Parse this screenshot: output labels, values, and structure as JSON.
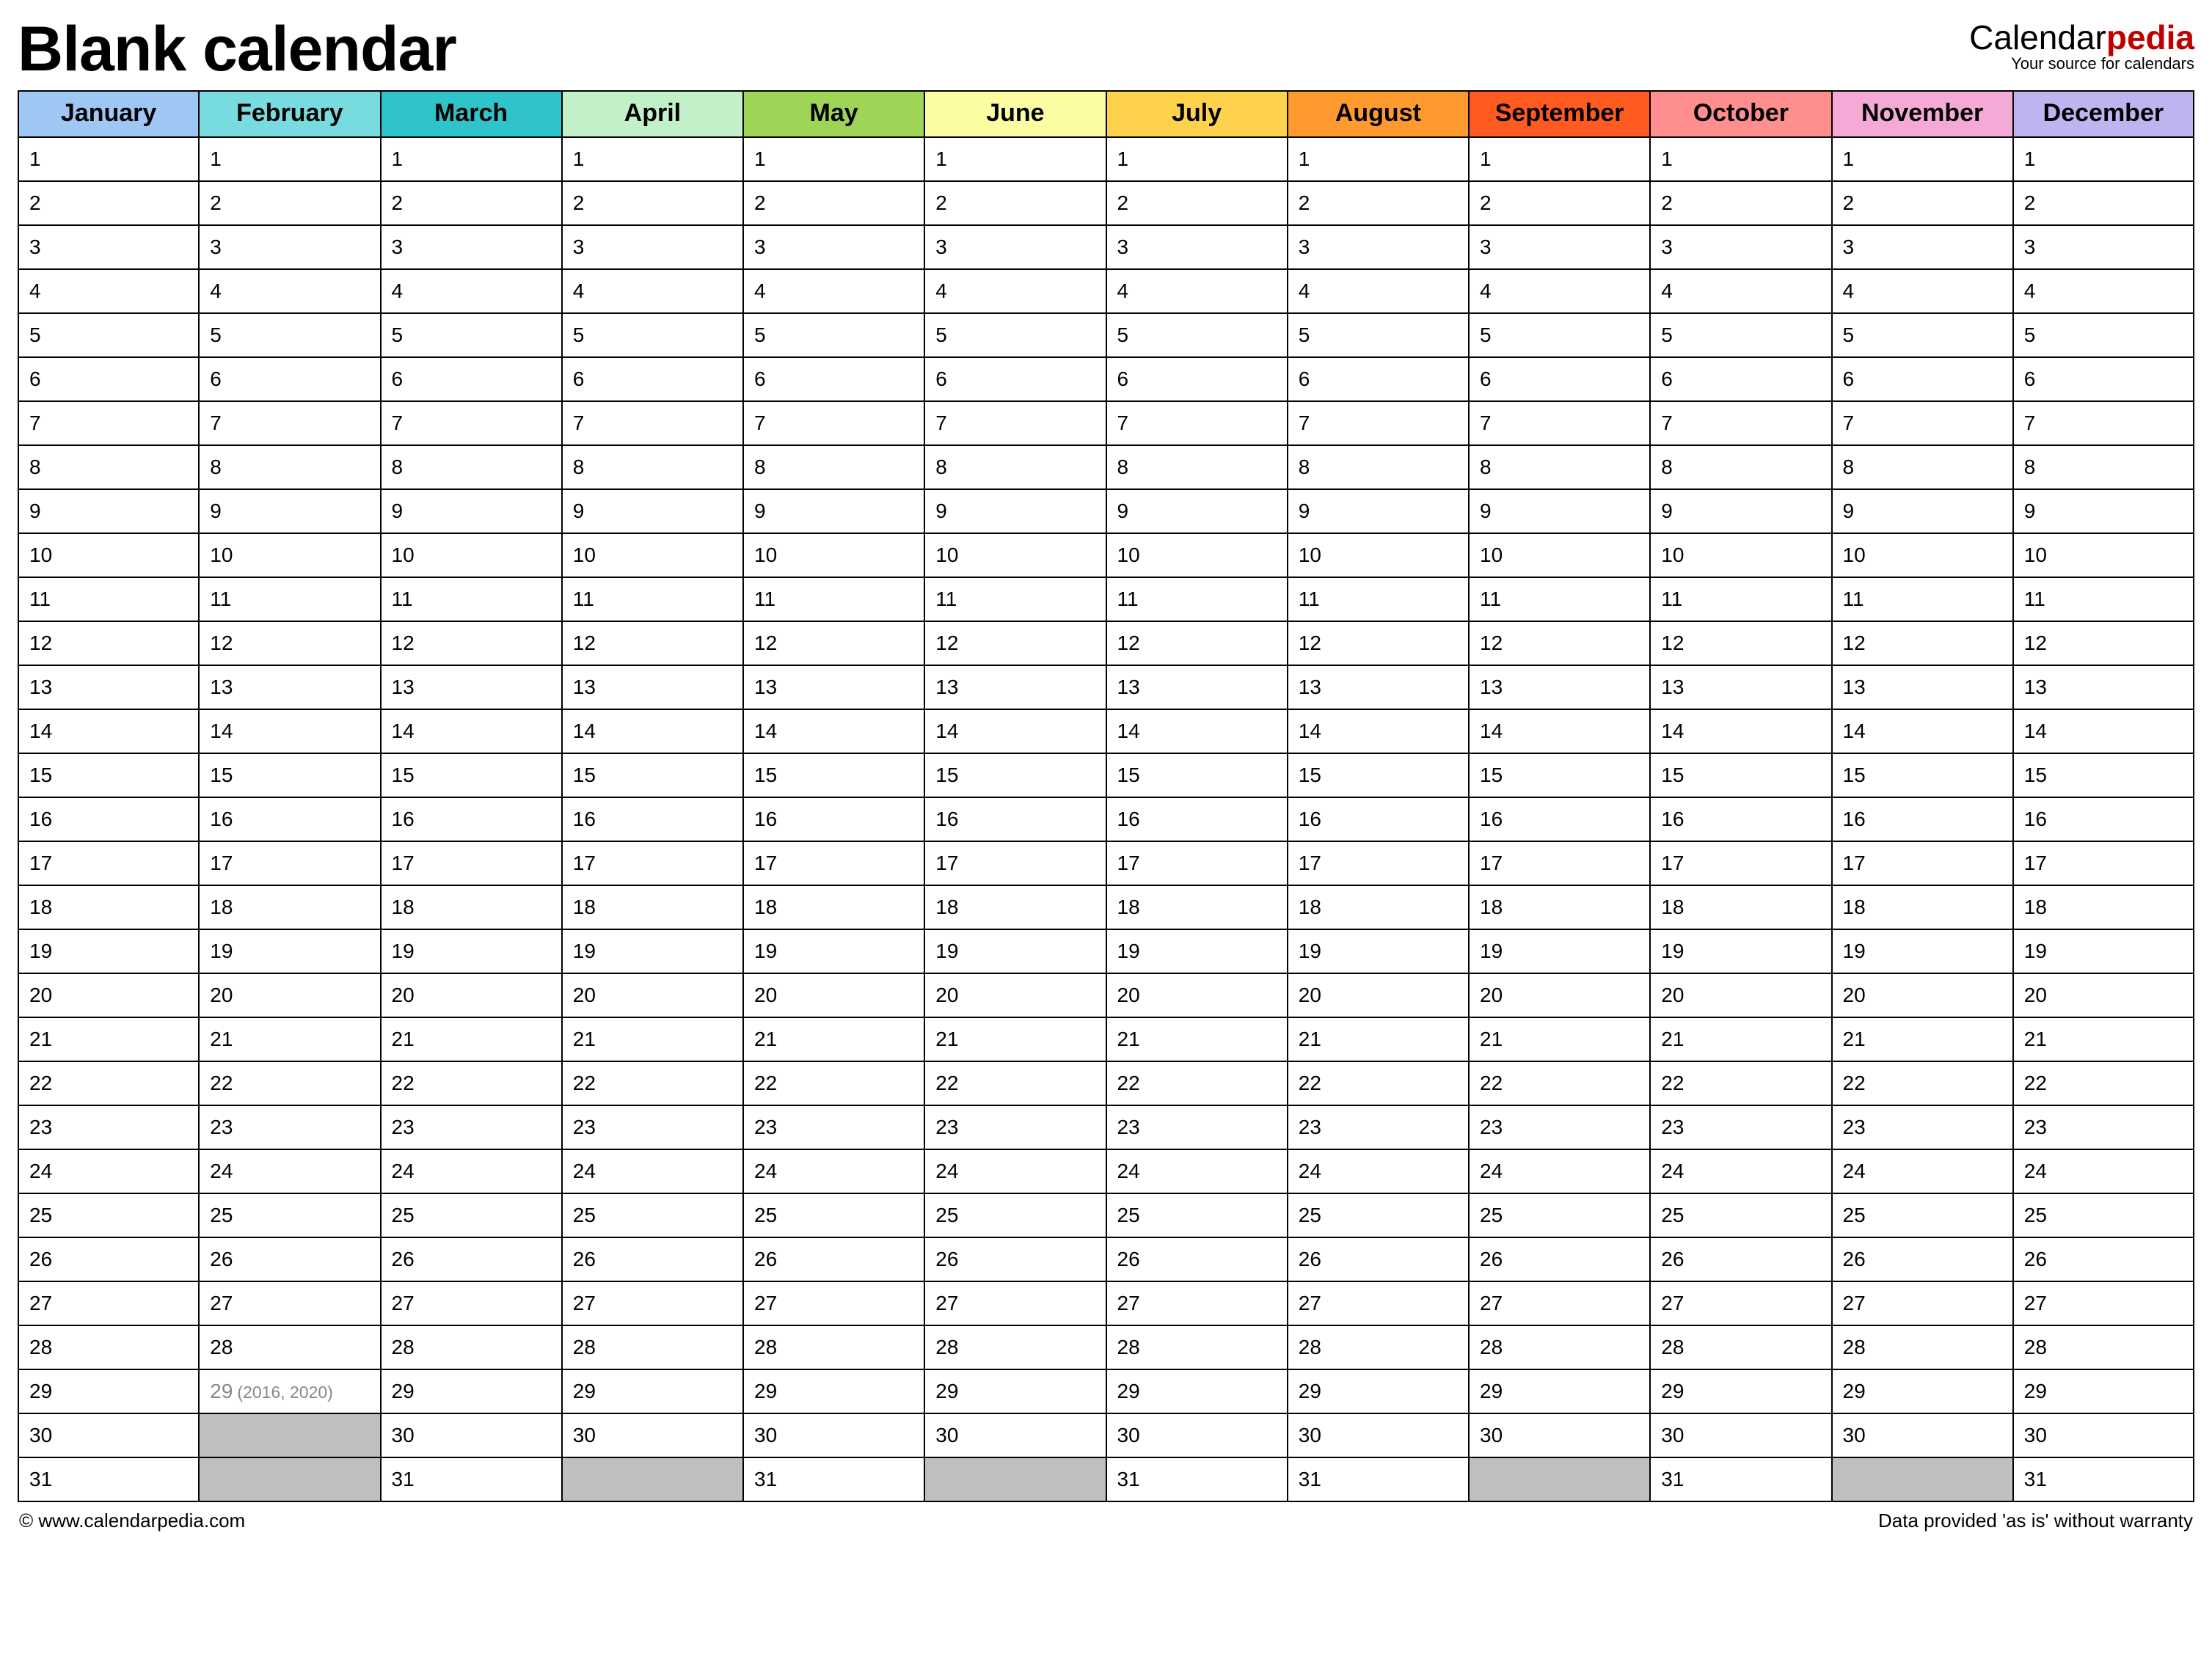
{
  "header": {
    "title": "Blank calendar",
    "brand_prefix": "Calendar",
    "brand_accent": "pedia",
    "brand_tagline": "Your source for calendars"
  },
  "months": [
    {
      "name": "January",
      "color": "#9ec7f4",
      "days": 31
    },
    {
      "name": "February",
      "color": "#78dbe0",
      "days": 28,
      "leap": {
        "day": 29,
        "note": "(2016, 2020)"
      }
    },
    {
      "name": "March",
      "color": "#2ec4c9",
      "days": 31
    },
    {
      "name": "April",
      "color": "#c2f0c9",
      "days": 30
    },
    {
      "name": "May",
      "color": "#9ed556",
      "days": 31
    },
    {
      "name": "June",
      "color": "#fcfca3",
      "days": 30
    },
    {
      "name": "July",
      "color": "#ffd24d",
      "days": 31
    },
    {
      "name": "August",
      "color": "#ff9a2e",
      "days": 31
    },
    {
      "name": "September",
      "color": "#ff5a1f",
      "days": 30
    },
    {
      "name": "October",
      "color": "#ff8f8f",
      "days": 31
    },
    {
      "name": "November",
      "color": "#f4a9d6",
      "days": 30
    },
    {
      "name": "December",
      "color": "#c0b4f0",
      "days": 31
    }
  ],
  "max_days": 31,
  "footer": {
    "copyright": "© www.calendarpedia.com",
    "disclaimer": "Data provided 'as is' without warranty"
  }
}
